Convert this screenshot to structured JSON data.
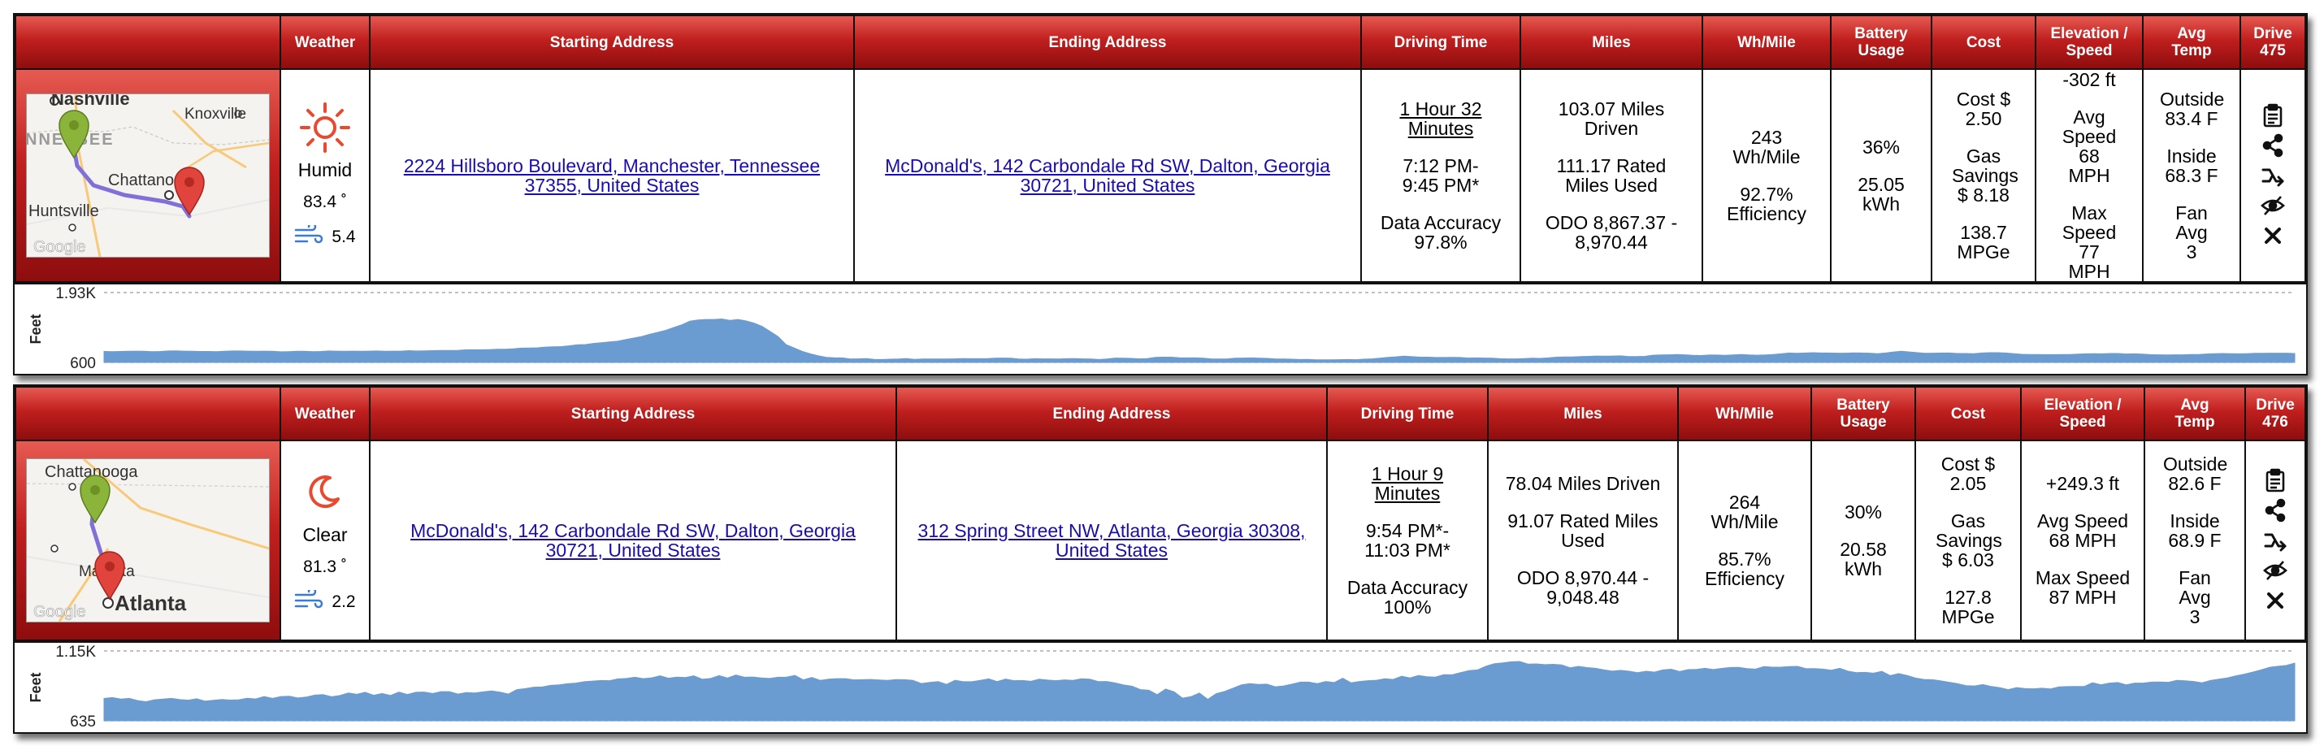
{
  "headers": {
    "weather": "Weather",
    "start": "Starting Address",
    "end": "Ending Address",
    "driving_time": "Driving Time",
    "miles": "Miles",
    "wh_mile": "Wh/Mile",
    "battery_line1": "Battery",
    "battery_line2": "Usage",
    "cost": "Cost",
    "elev_line1": "Elevation /",
    "elev_line2": "Speed",
    "temp_line1": "Avg",
    "temp_line2": "Temp"
  },
  "drives": [
    {
      "drive_line1": "Drive",
      "drive_number": "475",
      "map": {
        "labels": [
          "Nashville",
          "NNESSEE",
          "Knoxville",
          "Chattanooga",
          "Huntsville"
        ],
        "google": "Google"
      },
      "weather": {
        "icon": "sun-icon",
        "condition": "Humid",
        "temp": "83.4 ˚",
        "wind": "5.4"
      },
      "start_address": "2224 Hillsboro Boulevard, Manchester, Tennessee 37355, United States",
      "end_address": "McDonald's, 142 Carbondale Rd SW, Dalton, Georgia 30721, United States",
      "driving": {
        "duration": "1 Hour 32 Minutes",
        "times": "7:12 PM- 9:45 PM*",
        "accuracy": "Data Accuracy 97.8%"
      },
      "miles": {
        "driven": "103.07 Miles Driven",
        "rated": "111.17 Rated Miles Used",
        "odo": "ODO 8,867.37 - 8,970.44"
      },
      "wh": {
        "value": "243 Wh/Mile",
        "efficiency": "92.7% Efficiency"
      },
      "battery": {
        "pct": "36%",
        "kwh": "25.05 kWh"
      },
      "cost": {
        "cost": "Cost $ 2.50",
        "gas": "Gas Savings $ 8.18",
        "mpge": "138.7 MPGe"
      },
      "elevation": {
        "delta": "-302 ft",
        "avg": "Avg Speed 68 MPH",
        "max": "Max Speed 77 MPH"
      },
      "temp": {
        "outside": "Outside 83.4 F",
        "inside": "Inside 68.3 F",
        "fan": "Fan Avg 3"
      },
      "elevation_chart": {
        "ylabel": "Feet",
        "ymax_label": "1.93K",
        "ymin_label": "600",
        "ylim": [
          600,
          1930
        ],
        "color": "#6a9bd1",
        "values": [
          810,
          806,
          809,
          812,
          815,
          812,
          806,
          809,
          818,
          821,
          815,
          812,
          809,
          809,
          806,
          812,
          818,
          818,
          815,
          812,
          815,
          812,
          803,
          806,
          812,
          812,
          806,
          809,
          818,
          815,
          812,
          815,
          812,
          815,
          818,
          812,
          815,
          815,
          824,
          818,
          821,
          824,
          827,
          827,
          827,
          839,
          842,
          842,
          845,
          851,
          851,
          860,
          872,
          875,
          878,
          893,
          899,
          902,
          917,
          935,
          941,
          962,
          974,
          989,
          1004,
          1034,
          1064,
          1094,
          1136,
          1172,
          1211,
          1265,
          1316,
          1385,
          1409,
          1418,
          1418,
          1427,
          1400,
          1418,
          1391,
          1349,
          1286,
          1190,
          1094,
          938,
          875,
          812,
          764,
          728,
          698,
          689,
          686,
          665,
          668,
          674,
          659,
          656,
          662,
          665,
          674,
          659,
          665,
          665,
          665,
          665,
          668,
          674,
          671,
          671,
          671,
          680,
          683,
          680,
          665,
          662,
          671,
          668,
          668,
          665,
          671,
          674,
          668,
          665,
          656,
          665,
          683,
          680,
          677,
          668,
          674,
          698,
          701,
          701,
          689,
          686,
          686,
          680,
          668,
          665,
          668,
          680,
          683,
          686,
          680,
          677,
          665,
          665,
          662,
          656,
          659,
          650,
          650,
          650,
          653,
          656,
          653,
          662,
          668,
          680,
          698,
          707,
          719,
          710,
          701,
          701,
          695,
          695,
          698,
          695,
          683,
          686,
          683,
          680,
          671,
          668,
          668,
          674,
          680,
          677,
          686,
          701,
          704,
          704,
          713,
          716,
          722,
          719,
          722,
          725,
          713,
          713,
          716,
          737,
          743,
          746,
          752,
          746,
          734,
          731,
          740,
          740,
          734,
          743,
          752,
          743,
          737,
          743,
          752,
          764,
          779,
          773,
          779,
          785,
          779,
          779,
          776,
          776,
          782,
          779,
          776,
          767,
          779,
          800,
          812,
          800,
          785,
          773,
          776,
          779,
          779,
          770,
          770,
          767,
          779,
          785,
          785,
          779,
          767,
          755,
          752,
          752,
          749,
          749,
          752,
          752,
          758,
          764,
          767,
          764,
          770,
          770,
          761,
          764,
          758,
          749,
          746,
          743,
          746,
          746,
          752,
          752,
          761,
          767,
          770,
          767,
          764,
          767,
          773,
          773,
          776,
          776,
          776,
          770
        ]
      }
    },
    {
      "drive_line1": "Drive",
      "drive_number": "476",
      "map": {
        "labels": [
          "Chattanooga",
          "Marietta",
          "Atlanta"
        ],
        "google": "Google"
      },
      "weather": {
        "icon": "moon-icon",
        "condition": "Clear",
        "temp": "81.3 ˚",
        "wind": "2.2"
      },
      "start_address": "McDonald's, 142 Carbondale Rd SW, Dalton, Georgia 30721, United States",
      "end_address": "312 Spring Street NW, Atlanta, Georgia 30308, United States",
      "driving": {
        "duration": "1 Hour 9 Minutes",
        "times": "9:54 PM*- 11:03 PM*",
        "accuracy": "Data Accuracy 100%"
      },
      "miles": {
        "driven": "78.04 Miles Driven",
        "rated": "91.07 Rated Miles Used",
        "odo": "ODO 8,970.44 - 9,048.48"
      },
      "wh": {
        "value": "264 Wh/Mile",
        "efficiency": "85.7% Efficiency"
      },
      "battery": {
        "pct": "30%",
        "kwh": "20.58 kWh"
      },
      "cost": {
        "cost": "Cost $ 2.05",
        "gas": "Gas Savings $ 6.03",
        "mpge": "127.8 MPGe"
      },
      "elevation": {
        "delta": "+249.3 ft",
        "avg": "Avg Speed 68 MPH",
        "max": "Max Speed 87 MPH"
      },
      "temp": {
        "outside": "Outside 82.6 F",
        "inside": "Inside 68.9 F",
        "fan": "Fan Avg 3"
      },
      "elevation_chart": {
        "ylabel": "Feet",
        "ymax_label": "1.15K",
        "ymin_label": "635",
        "ylim": [
          635,
          1150
        ],
        "color": "#6a9bd1",
        "values": [
          800,
          806,
          795,
          800,
          784,
          776,
          790,
          795,
          800,
          791,
          787,
          797,
          780,
          786,
          792,
          788,
          790,
          801,
          796,
          814,
          800,
          814,
          816,
          803,
          810,
          824,
          828,
          812,
          821,
          840,
          830,
          845,
          823,
          836,
          822,
          847,
          829,
          845,
          847,
          836,
          850,
          850,
          832,
          843,
          840,
          848,
          855,
          846,
          832,
          865,
          872,
          883,
          884,
          896,
          900,
          908,
          913,
          923,
          928,
          932,
          931,
          944,
          947,
          956,
          946,
          952,
          967,
          949,
          957,
          954,
          966,
          941,
          947,
          968,
          950,
          973,
          956,
          958,
          951,
          947,
          956,
          957,
          969,
          937,
          954,
          933,
          942,
          946,
          946,
          937,
          938,
          940,
          936,
          933,
          939,
          938,
          933,
          910,
          918,
          924,
          903,
          934,
          923,
          923,
          933,
          944,
          924,
          942,
          931,
          932,
          926,
          942,
          935,
          931,
          937,
          933,
          945,
          942,
          924,
          925,
          914,
          899,
          891,
          865,
          860,
          828,
          869,
          849,
          802,
          813,
          840,
          793,
          835,
          851,
          875,
          900,
          909,
          903,
          905,
          886,
          892,
          905,
          920,
          920,
          909,
          925,
          917,
          949,
          915,
          925,
          931,
          934,
          945,
          940,
          964,
          951,
          969,
          960,
          957,
          975,
          974,
          990,
          1005,
          1010,
          1037,
          1056,
          1062,
          1070,
          1072,
          1053,
          1054,
          1049,
          1051,
          1047,
          1026,
          1036,
          1027,
          1022,
          1011,
          1001,
          1007,
          1000,
          990,
          1000,
          994,
          1010,
          1015,
          998,
          1012,
          1014,
          1022,
          1013,
          1021,
          1028,
          1029,
          1020,
          1016,
          1035,
          1030,
          1030,
          1035,
          1036,
          1019,
          1020,
          1016,
          1008,
          1022,
          1000,
          990,
          992,
          986,
          999,
          968,
          983,
          969,
          950,
          940,
          938,
          929,
          919,
          908,
          894,
          892,
          902,
          888,
          879,
          865,
          880,
          872,
          871,
          875,
          870,
          885,
          887,
          888,
          888,
          916,
          901,
          913,
          917,
          900,
          913,
          913,
          920,
          921,
          919,
          933,
          930,
          925,
          915,
          932,
          942,
          951,
          966,
          979,
          994,
          1010,
          1029,
          1037,
          1043,
          1060
        ]
      }
    }
  ]
}
